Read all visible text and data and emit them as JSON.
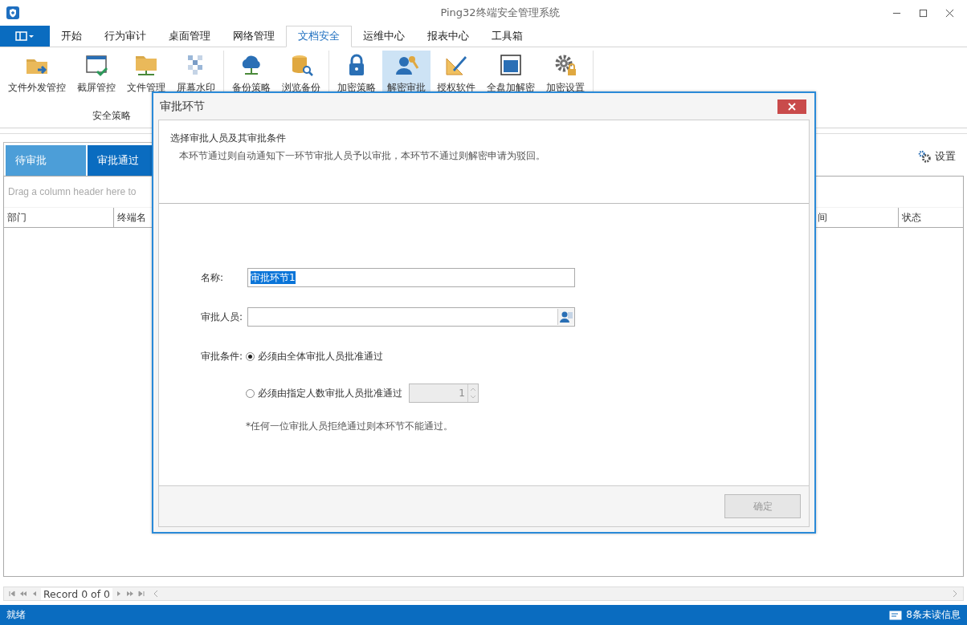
{
  "window": {
    "title": "Ping32终端安全管理系统"
  },
  "menu_tabs": [
    {
      "label": "开始",
      "selected": false
    },
    {
      "label": "行为审计",
      "selected": false
    },
    {
      "label": "桌面管理",
      "selected": false
    },
    {
      "label": "网络管理",
      "selected": false
    },
    {
      "label": "文档安全",
      "selected": true
    },
    {
      "label": "运维中心",
      "selected": false
    },
    {
      "label": "报表中心",
      "selected": false
    },
    {
      "label": "工具箱",
      "selected": false
    }
  ],
  "ribbon": {
    "groups": [
      {
        "label": "安全策略",
        "items": [
          {
            "label": "文件外发管控",
            "selected": false
          },
          {
            "label": "截屏管控",
            "selected": false
          },
          {
            "label": "文件管理",
            "selected": false
          },
          {
            "label": "屏幕水印",
            "selected": false
          }
        ]
      },
      {
        "items": [
          {
            "label": "备份策略",
            "selected": false
          },
          {
            "label": "浏览备份",
            "selected": false
          }
        ]
      },
      {
        "items": [
          {
            "label": "加密策略",
            "selected": false
          },
          {
            "label": "解密审批",
            "selected": true
          },
          {
            "label": "授权软件",
            "selected": false
          },
          {
            "label": "全盘加解密",
            "selected": false
          },
          {
            "label": "加密设置",
            "selected": false
          }
        ]
      }
    ]
  },
  "view_tabs": [
    {
      "label": "待审批",
      "selected": true
    },
    {
      "label": "审批通过",
      "selected": false
    }
  ],
  "settings_button": "设置",
  "grid": {
    "group_hint": "Drag a column header here to",
    "columns": [
      "部门",
      "终端名",
      "间",
      "状态"
    ]
  },
  "navigator": {
    "record": "Record 0 of 0"
  },
  "dialog": {
    "title": "审批环节",
    "heading": "选择审批人员及其审批条件",
    "description": "本环节通过则自动通知下一环节审批人员予以审批，本环节不通过则解密申请为驳回。",
    "fields": [
      {
        "label": "名称:",
        "value": "审批环节1",
        "picker": false
      },
      {
        "label": "审批人员:",
        "picker": true
      }
    ],
    "condition_label": "审批条件:",
    "conditions": [
      {
        "label": "必须由全体审批人员批准通过",
        "selected": true
      },
      {
        "label": "必须由指定人数审批人员批准通过",
        "selected": false,
        "count": "1"
      }
    ],
    "note": "*任何一位审批人员拒绝通过则本环节不能通过。",
    "ok_button": {
      "label": "确定",
      "disabled": true
    }
  },
  "status_bar": {
    "text": "就绪",
    "messages": "8条未读信息"
  }
}
